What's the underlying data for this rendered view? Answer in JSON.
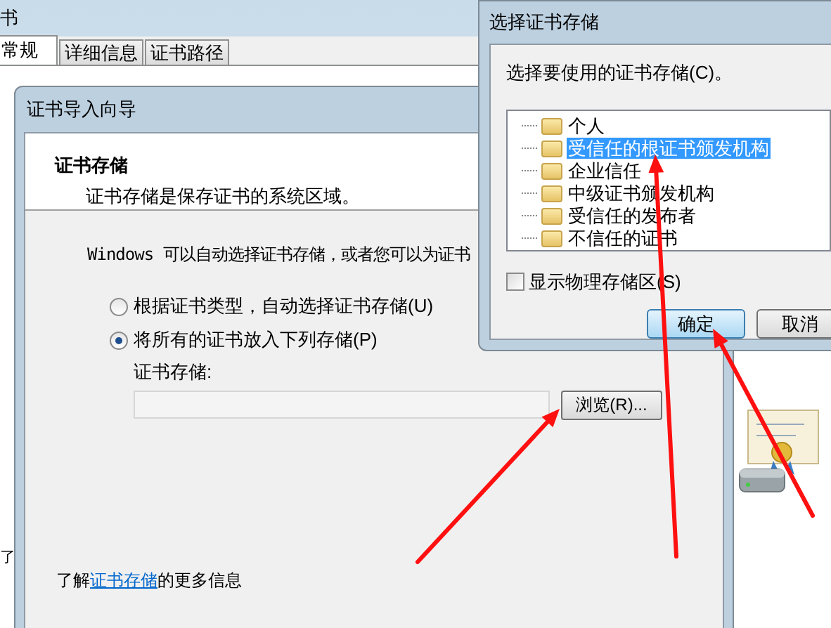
{
  "background_window": {
    "title": "书",
    "tabs": [
      {
        "label": "常规",
        "selected": true
      },
      {
        "label": "详细信息",
        "selected": false
      },
      {
        "label": "证书路径",
        "selected": false
      }
    ],
    "edge_text": "了"
  },
  "wizard": {
    "title": "证书导入向导",
    "header": {
      "title": "证书存储",
      "description": "证书存储是保存证书的系统区域。"
    },
    "intro": "Windows 可以自动选择证书存储，或者您可以为证书",
    "options": [
      {
        "label": "根据证书类型，自动选择证书存储(U)",
        "selected": false
      },
      {
        "label": "将所有的证书放入下列存储(P)",
        "selected": true
      }
    ],
    "store_label": "证书存储:",
    "browse_button": "浏览(R)...",
    "footer": {
      "before": "了解",
      "link": "证书存储",
      "after": "的更多信息"
    }
  },
  "dialog": {
    "title": "选择证书存储",
    "prompt": "选择要使用的证书存储(C)。",
    "stores": [
      {
        "label": "个人",
        "selected": false
      },
      {
        "label": "受信任的根证书颁发机构",
        "selected": true
      },
      {
        "label": "企业信任",
        "selected": false
      },
      {
        "label": "中级证书颁发机构",
        "selected": false
      },
      {
        "label": "受信任的发布者",
        "selected": false
      },
      {
        "label": "不信任的证书",
        "selected": false
      }
    ],
    "show_physical": {
      "label": "显示物理存储区(S)",
      "checked": false
    },
    "buttons": [
      {
        "label": "确定",
        "default": true
      },
      {
        "label": "取消",
        "default": false
      }
    ]
  }
}
